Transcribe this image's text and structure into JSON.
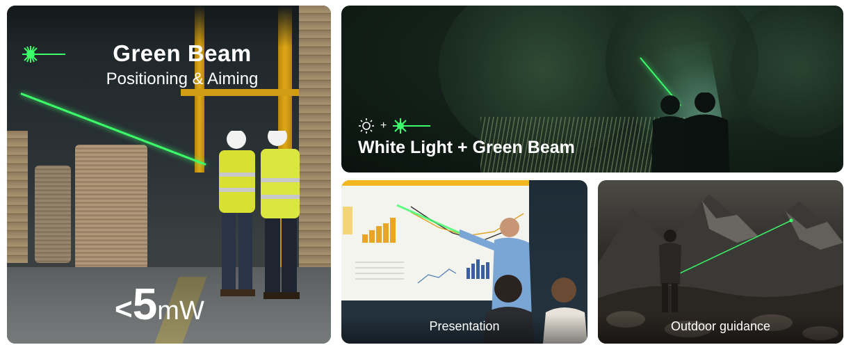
{
  "left_card": {
    "title": "Green Beam",
    "subtitle": "Positioning & Aiming",
    "power_prefix": "<",
    "power_value": "5",
    "power_unit": "mW",
    "icon": "green-laser-burst-icon"
  },
  "night_card": {
    "label": "White Light + Green Beam",
    "icons": [
      "sun-icon",
      "green-laser-burst-icon"
    ],
    "plus": "+"
  },
  "presentation_card": {
    "caption": "Presentation"
  },
  "outdoor_card": {
    "caption": "Outdoor guidance"
  },
  "colors": {
    "laser_green": "#3cff6a",
    "accent_yellow": "#f0b71f"
  }
}
